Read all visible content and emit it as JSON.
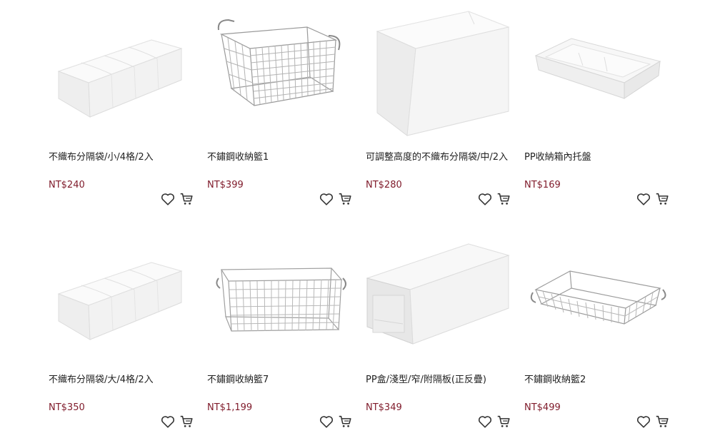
{
  "colors": {
    "price": "#7f1a2a",
    "text": "#222222",
    "icon": "#333333"
  },
  "products": [
    {
      "name": "不織布分隔袋/小/4格/2入",
      "price": "NT$240",
      "image": "white-fabric-divider-bag"
    },
    {
      "name": "不鏽鋼收納籃1",
      "price": "NT$399",
      "image": "stainless-wire-basket-tall"
    },
    {
      "name": "可調整高度的不織布分隔袋/中/2入",
      "price": "NT$280",
      "image": "white-fabric-tall-bag"
    },
    {
      "name": "PP收納箱內托盤",
      "price": "NT$169",
      "image": "pp-tray"
    },
    {
      "name": "不織布分隔袋/大/4格/2入",
      "price": "NT$350",
      "image": "white-fabric-divider-bag"
    },
    {
      "name": "不鏽鋼收納籃7",
      "price": "NT$1,199",
      "image": "stainless-wire-basket-wide"
    },
    {
      "name": "PP盒/淺型/窄/附隔板(正反疊)",
      "price": "NT$349",
      "image": "pp-drawer-box"
    },
    {
      "name": "不鏽鋼收納籃2",
      "price": "NT$499",
      "image": "stainless-wire-basket-shallow"
    }
  ],
  "icons": {
    "favorite": "heart-icon",
    "cart": "cart-icon"
  }
}
